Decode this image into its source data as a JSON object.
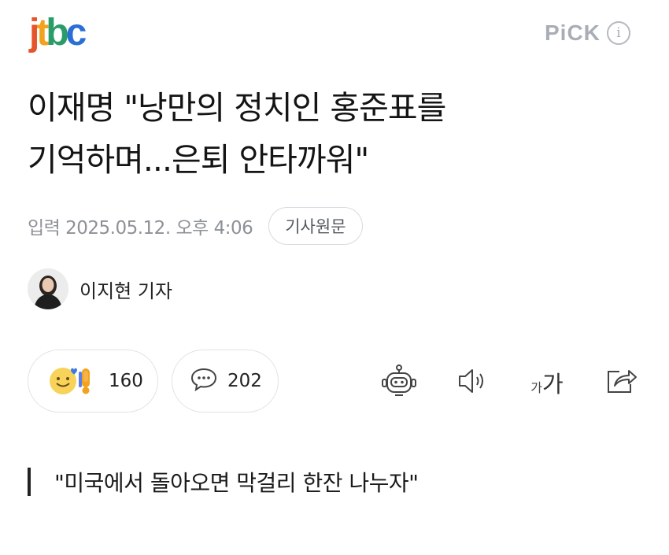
{
  "header": {
    "logo": {
      "j": "j",
      "t": "t",
      "b": "b",
      "c": "c"
    },
    "pick_label": "PiCK",
    "info_glyph": "i"
  },
  "article": {
    "title_line1": "이재명 \"낭만의 정치인 홍준표를",
    "title_line2": "기억하며...은퇴 안타까워\"",
    "date": "입력 2025.05.12. 오후 4:06",
    "original_button": "기사원문",
    "author": "이지현 기자",
    "quote": "\"미국에서 돌아오면 막걸리 한잔 나누자\""
  },
  "actions": {
    "reaction_count": "160",
    "comment_count": "202",
    "font_small": "가",
    "font_big": "가"
  },
  "icons": {
    "reaction": "smile-emoji-icon",
    "comment": "comment-bubble-icon",
    "summary": "robot-icon",
    "tts": "speaker-icon",
    "font": "font-size-icon",
    "share": "share-icon"
  },
  "colors": {
    "logo_j": "#e5542a",
    "logo_t": "#f2a21c",
    "logo_b": "#2a9c6a",
    "logo_c": "#2b6fd6",
    "pick": "#a9aeb6"
  }
}
